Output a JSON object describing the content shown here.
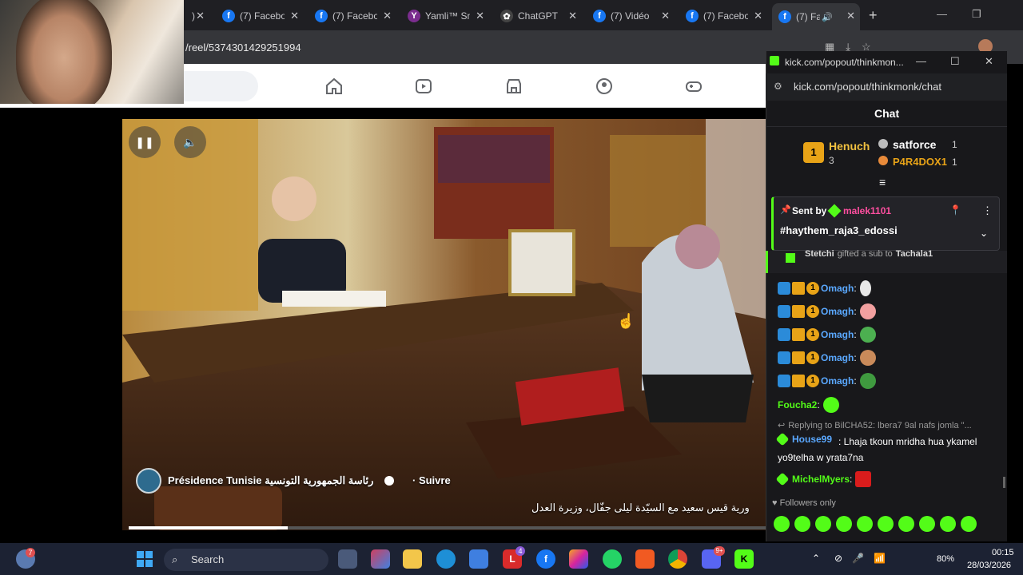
{
  "browser": {
    "tabs": [
      {
        "title": "(7) Facebo",
        "icon": "facebook-icon",
        "active": false
      },
      {
        "title": "(7) Facebo",
        "icon": "facebook-icon",
        "active": false
      },
      {
        "title": "Yamli™ Sm",
        "icon": "yamli-icon",
        "active": false
      },
      {
        "title": "ChatGPT",
        "icon": "chatgpt-icon",
        "active": false
      },
      {
        "title": "(7) Vidéo",
        "icon": "facebook-icon",
        "active": false
      },
      {
        "title": "(7) Facebo",
        "icon": "facebook-icon",
        "active": false
      },
      {
        "title": "(7) Fa",
        "icon": "facebook-icon",
        "active": true
      }
    ],
    "url": "/reel/5374301429251994"
  },
  "video": {
    "page_name": "Présidence Tunisie رئاسة الجمهورية التونسية",
    "follow_label": "· Suivre",
    "caption": "ورية قيس سعيد مع السيّدة ليلى جفّال، وزيرة العدل",
    "progress": 0.25
  },
  "popup": {
    "window_title": "kick.com/popout/thinkmon...",
    "url": "kick.com/popout/thinkmonk/chat",
    "chat_title": "Chat",
    "leaderboard": [
      {
        "rank": "1",
        "name": "Henuch",
        "count": "3"
      },
      {
        "name": "satforce",
        "count": "1"
      },
      {
        "name": "P4R4DOX1",
        "count": "1"
      }
    ],
    "pinned": {
      "sent_by_label": "Sent by",
      "sender": "malek1101",
      "text": "#haythem_raja3_edossi"
    },
    "gift_text": {
      "user": "Stetchi",
      "action": "gifted a sub to",
      "target": "Tachala1"
    },
    "messages": [
      {
        "user": "Omagh",
        "text": ":"
      },
      {
        "user": "Omagh",
        "text": ":"
      },
      {
        "user": "Omagh",
        "text": ":"
      },
      {
        "user": "Omagh",
        "text": ":"
      },
      {
        "user": "Omagh",
        "text": ":"
      },
      {
        "user": "Foucha2",
        "text": ":"
      },
      {
        "reply": "Replying to BilCHA52: lbera7 9al nafs jomla \"...",
        "user": "House99",
        "text": ": Lhaja tkoun mridha hua ykamel yo9telha w yrata7na"
      },
      {
        "user": "MichelMyers",
        "text": ":"
      }
    ],
    "followers_only": "Followers only"
  },
  "taskbar": {
    "search_label": "Search",
    "battery": "80%",
    "time": "00:15",
    "date": "28/03/2026",
    "notif_badge": "7",
    "lucky_badge": "4",
    "discord_badge": "9+"
  },
  "colors": {
    "kick_green": "#53fc18",
    "facebook_blue": "#1877f2",
    "chat_user_blue": "#5aa8ff",
    "sender_pink": "#ff4fa0"
  }
}
